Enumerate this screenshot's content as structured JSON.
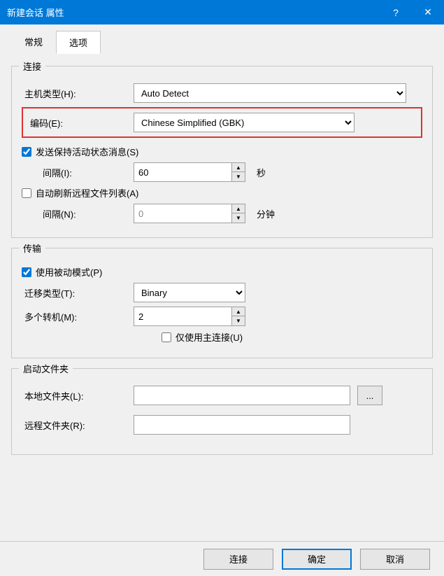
{
  "window": {
    "title": "新建会话 属性",
    "help": "?",
    "close": "✕"
  },
  "tabs": {
    "general": "常规",
    "options": "选项"
  },
  "connection": {
    "legend": "连接",
    "host_type_label": "主机类型(H):",
    "host_type_value": "Auto Detect",
    "encoding_label": "编码(E):",
    "encoding_value": "Chinese Simplified (GBK)",
    "keepalive_label": "发送保持活动状态消息(S)",
    "keepalive_interval_label": "间隔(I):",
    "keepalive_interval_value": "60",
    "keepalive_unit": "秒",
    "autorefresh_label": "自动刷新远程文件列表(A)",
    "autorefresh_interval_label": "间隔(N):",
    "autorefresh_interval_value": "0",
    "autorefresh_unit": "分钟"
  },
  "transfer": {
    "legend": "传输",
    "passive_label": "使用被动模式(P)",
    "transfer_type_label": "迁移类型(T):",
    "transfer_type_value": "Binary",
    "multi_label": "多个转机(M):",
    "multi_value": "2",
    "main_only_label": "仅使用主连接(U)"
  },
  "startup": {
    "legend": "启动文件夹",
    "local_label": "本地文件夹(L):",
    "local_value": "",
    "remote_label": "远程文件夹(R):",
    "remote_value": "",
    "browse": "..."
  },
  "footer": {
    "connect": "连接",
    "ok": "确定",
    "cancel": "取消"
  }
}
